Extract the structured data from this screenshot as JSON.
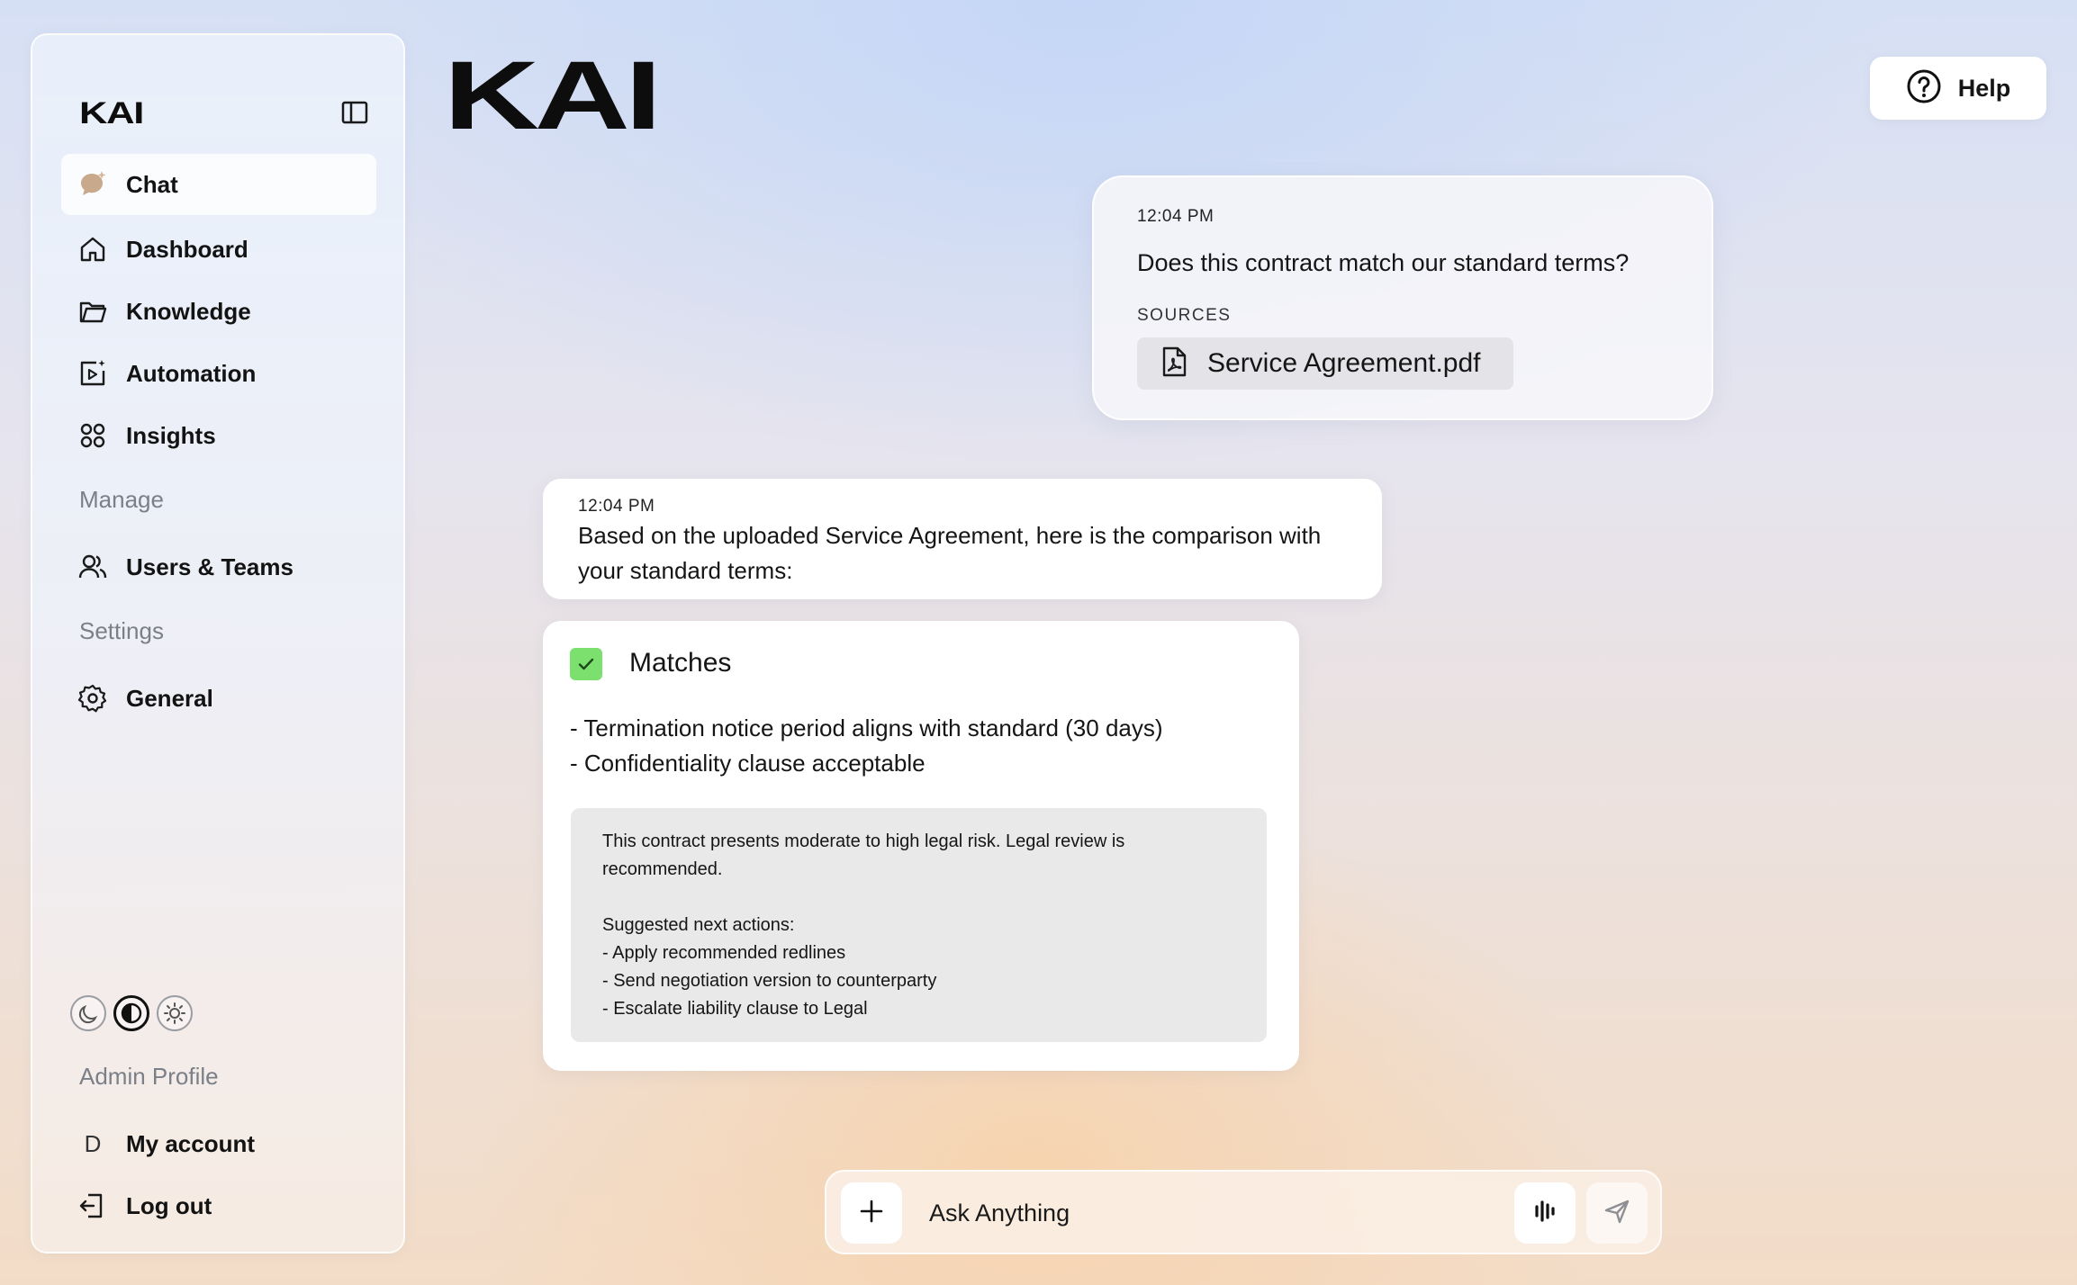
{
  "brand": {
    "name": "KAI"
  },
  "sidebar": {
    "nav": [
      {
        "label": "Chat",
        "icon": "chat-sparkle-icon",
        "active": true
      },
      {
        "label": "Dashboard",
        "icon": "home-icon"
      },
      {
        "label": "Knowledge",
        "icon": "folder-icon"
      },
      {
        "label": "Automation",
        "icon": "automation-icon"
      },
      {
        "label": "Insights",
        "icon": "grid-icon"
      }
    ],
    "manage_label": "Manage",
    "manage_items": [
      {
        "label": "Users & Teams",
        "icon": "users-icon"
      }
    ],
    "settings_label": "Settings",
    "settings_items": [
      {
        "label": "General",
        "icon": "gear-icon"
      }
    ],
    "theme_options": [
      "dark-mode-icon",
      "contrast-icon",
      "light-mode-icon"
    ],
    "profile_label": "Admin Profile",
    "account": {
      "avatar_letter": "D",
      "label": "My account"
    },
    "logout_label": "Log out"
  },
  "header": {
    "help_label": "Help"
  },
  "conversation": {
    "user_message": {
      "time": "12:04 PM",
      "text": "Does this contract match our standard terms?",
      "sources_label": "SOURCES",
      "source_file": "Service Agreement.pdf"
    },
    "assistant_message": {
      "time": "12:04 PM",
      "text": "Based on the uploaded Service Agreement, here is the comparison with your standard terms:"
    },
    "matches_card": {
      "title": "Matches",
      "lines": [
        "- Termination notice period aligns with standard (30 days)",
        "- Confidentiality clause acceptable"
      ],
      "risk_note": "This contract presents moderate to high legal risk. Legal review is recommended.",
      "next_actions_label": "Suggested next actions:",
      "next_actions": [
        "- Apply recommended redlines",
        "- Send negotiation version to counterparty",
        "- Escalate liability clause to Legal"
      ]
    }
  },
  "composer": {
    "placeholder": "Ask Anything"
  },
  "colors": {
    "match_green": "#7be06e",
    "chat_icon": "#c9a98c"
  }
}
